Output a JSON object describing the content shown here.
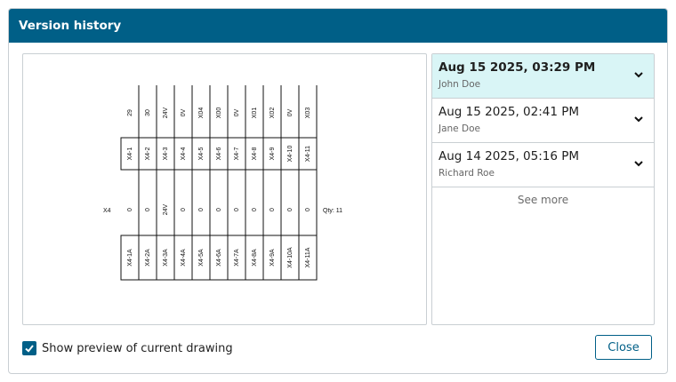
{
  "dialog": {
    "title": "Version history"
  },
  "drawing": {
    "strip_label": "X4",
    "qty_label": "Qty: 11",
    "top_wire_labels": [
      "29",
      "30",
      "24V",
      "0V",
      "X04",
      "X00",
      "0V",
      "X01",
      "X02",
      "0V",
      "X03"
    ],
    "terminals": [
      "X4-1",
      "X4-2",
      "X4-3",
      "X4-4",
      "X4-5",
      "X4-6",
      "X4-7",
      "X4-8",
      "X4-9",
      "X4-10",
      "X4-11"
    ],
    "mid_wire_labels": [
      "0",
      "0",
      "24V",
      "0",
      "0",
      "0",
      "0",
      "0",
      "0",
      "0",
      "0"
    ],
    "bottom_terminals": [
      "X4-1A",
      "X4-2A",
      "X4-3A",
      "X4-4A",
      "X4-5A",
      "X4-6A",
      "X4-7A",
      "X4-8A",
      "X4-9A",
      "X4-10A",
      "X4-11A"
    ]
  },
  "versions": {
    "items": [
      {
        "date": "Aug 15 2025, 03:29 PM",
        "author": "John Doe",
        "selected": true
      },
      {
        "date": "Aug 15 2025, 02:41 PM",
        "author": "Jane Doe",
        "selected": false
      },
      {
        "date": "Aug 14 2025, 05:16 PM",
        "author": "Richard Roe",
        "selected": false
      }
    ],
    "see_more_label": "See more"
  },
  "footer": {
    "show_preview_label": "Show preview of current drawing",
    "show_preview_checked": true,
    "close_label": "Close"
  },
  "colors": {
    "header": "#005f87",
    "selected_row": "#d9f5f6"
  }
}
